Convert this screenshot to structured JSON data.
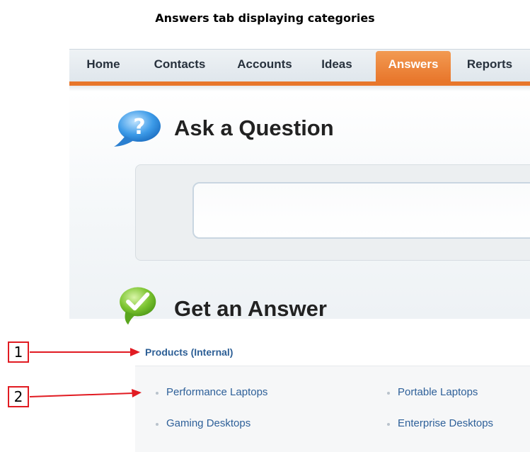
{
  "caption": "Answers tab displaying categories",
  "tabs": [
    {
      "label": "Home"
    },
    {
      "label": "Contacts"
    },
    {
      "label": "Accounts"
    },
    {
      "label": "Ideas"
    },
    {
      "label": "Answers",
      "active": true
    },
    {
      "label": "Reports"
    }
  ],
  "ask": {
    "title": "Ask a Question",
    "icon": "question-bubble-icon",
    "input_value": ""
  },
  "answer": {
    "title": "Get an Answer",
    "icon": "checkmark-bubble-icon",
    "category": "Products (Internal)",
    "subcategories": [
      "Performance Laptops",
      "Portable Laptops",
      "Gaming Desktops",
      "Enterprise Desktops"
    ]
  },
  "callouts": [
    "1",
    "2"
  ],
  "colors": {
    "accent_orange": "#e8762b",
    "link_blue": "#2d5f96",
    "callout_red": "#e11b22"
  }
}
